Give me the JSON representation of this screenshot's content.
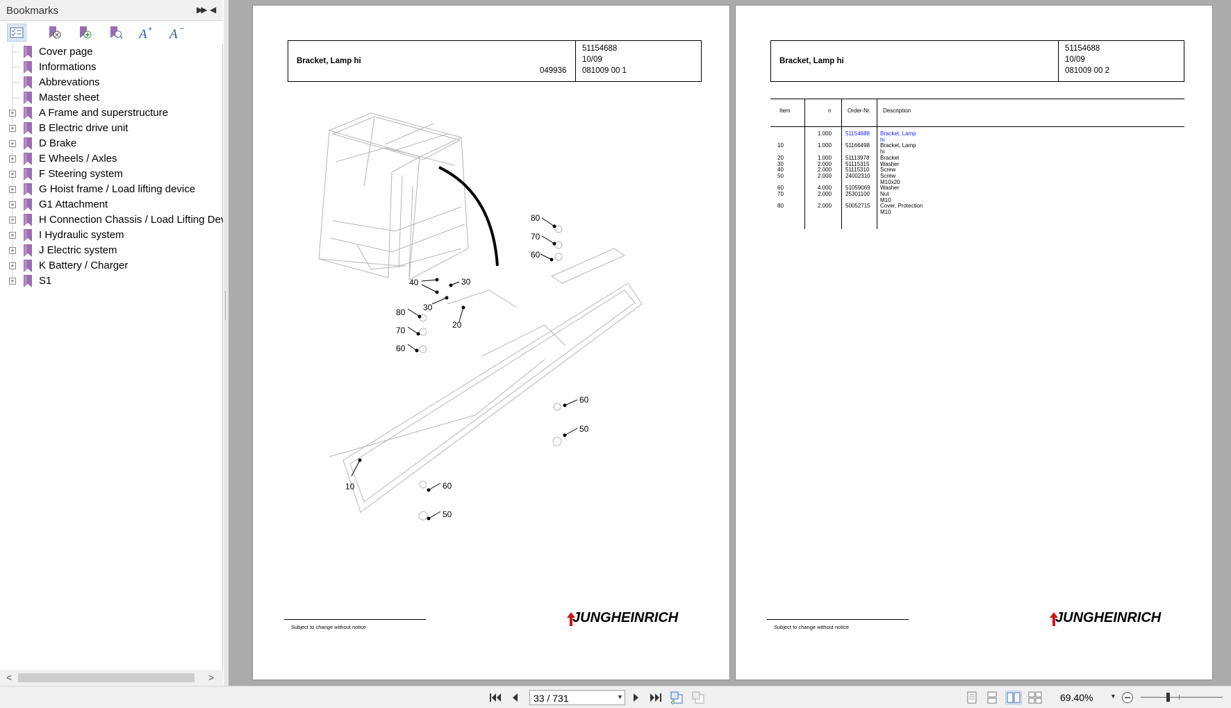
{
  "sidebar": {
    "title": "Bookmarks",
    "expand_icon": "double-arrow-right",
    "collapse_icon": "arrow-left",
    "toolbar": [
      {
        "name": "expand-bookmark-options-icon"
      },
      {
        "name": "delete-bookmark-icon"
      },
      {
        "name": "add-bookmark-icon"
      },
      {
        "name": "find-bookmark-icon"
      },
      {
        "name": "increase-font-icon"
      },
      {
        "name": "decrease-font-icon"
      }
    ],
    "items": [
      {
        "label": "Cover page",
        "expandable": false
      },
      {
        "label": "Informations",
        "expandable": false
      },
      {
        "label": "Abbrevations",
        "expandable": false
      },
      {
        "label": "Master sheet",
        "expandable": false
      },
      {
        "label": "A Frame and superstructure",
        "expandable": true
      },
      {
        "label": "B Electric drive unit",
        "expandable": true
      },
      {
        "label": "D Brake",
        "expandable": true
      },
      {
        "label": "E Wheels / Axles",
        "expandable": true
      },
      {
        "label": "F Steering system",
        "expandable": true
      },
      {
        "label": "G Hoist frame / Load lifting device",
        "expandable": true
      },
      {
        "label": "G1 Attachment",
        "expandable": true
      },
      {
        "label": "H Connection Chassis / Load Lifting Devi",
        "expandable": true
      },
      {
        "label": "I Hydraulic system",
        "expandable": true
      },
      {
        "label": "J Electric system",
        "expandable": true
      },
      {
        "label": "K Battery / Charger",
        "expandable": true
      },
      {
        "label": "S1",
        "expandable": true
      }
    ]
  },
  "page_left": {
    "title": "Bracket, Lamp hi",
    "code": "049936",
    "part_no": "51154688",
    "date": "10/09",
    "sheet": "081009 00 1",
    "callouts": [
      "80",
      "70",
      "60",
      "40",
      "30",
      "30",
      "20",
      "80",
      "70",
      "60",
      "60",
      "50",
      "10",
      "60",
      "50"
    ],
    "footer_note": "Subject to change without notice",
    "logo": "JUNGHEINRICH"
  },
  "page_right": {
    "title": "Bracket, Lamp hi",
    "part_no": "51154688",
    "date": "10/09",
    "sheet": "081009 00 2",
    "footer_note": "Subject to change without notice",
    "logo": "JUNGHEINRICH",
    "table": {
      "headers": {
        "item": "Item",
        "n": "n",
        "order": "Order-Nr.",
        "desc": "Description"
      },
      "rows": [
        {
          "item": "",
          "n": "1.000",
          "order": "51154688",
          "desc": [
            "Bracket, Lamp",
            "hi"
          ],
          "link": true
        },
        {
          "item": "10",
          "n": "1.000",
          "order": "51166498",
          "desc": [
            "Bracket, Lamp",
            "hi"
          ],
          "link": false
        },
        {
          "item": "20",
          "n": "1.000",
          "order": "51113978",
          "desc": [
            "Bracket"
          ],
          "link": false
        },
        {
          "item": "30",
          "n": "2.000",
          "order": "51115315",
          "desc": [
            "Washer"
          ],
          "link": false
        },
        {
          "item": "40",
          "n": "2.000",
          "order": "51115310",
          "desc": [
            "Screw"
          ],
          "link": false
        },
        {
          "item": "50",
          "n": "2.000",
          "order": "24002310",
          "desc": [
            "Screw",
            "M10x20"
          ],
          "link": false
        },
        {
          "item": "60",
          "n": "4.000",
          "order": "51059069",
          "desc": [
            "Washer"
          ],
          "link": false
        },
        {
          "item": "70",
          "n": "2.000",
          "order": "25301100",
          "desc": [
            "Nut",
            "M10"
          ],
          "link": false
        },
        {
          "item": "80",
          "n": "2.000",
          "order": "50052715",
          "desc": [
            "Cover, Protection",
            "M10"
          ],
          "link": false
        }
      ]
    }
  },
  "statusbar": {
    "page_display": "33 / 731",
    "zoom": "69.40%"
  }
}
